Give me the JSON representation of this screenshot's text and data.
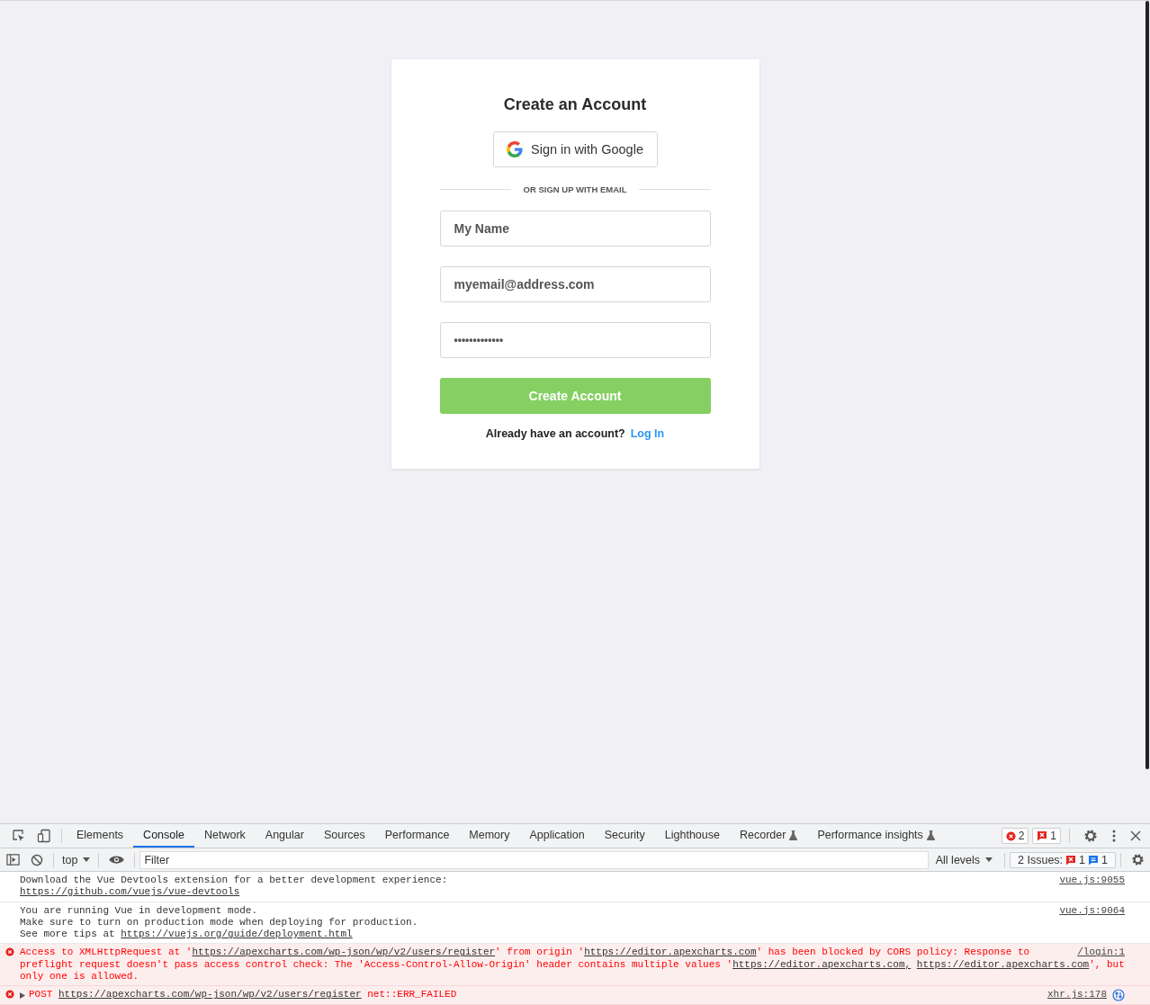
{
  "form": {
    "title": "Create an Account",
    "google_button": "Sign in with Google",
    "divider": "OR SIGN UP WITH EMAIL",
    "fields": [
      {
        "kind": "name",
        "value": "My Name"
      },
      {
        "kind": "email",
        "value": "myemail@address.com"
      },
      {
        "kind": "password",
        "value": "•••••••••••••"
      }
    ],
    "submit": "Create Account",
    "footer_text": "Already have an account?",
    "login_link": "Log In"
  },
  "devtools": {
    "tabs": [
      {
        "label": "Elements",
        "selected": false,
        "experimental": false
      },
      {
        "label": "Console",
        "selected": true,
        "experimental": false
      },
      {
        "label": "Network",
        "selected": false,
        "experimental": false
      },
      {
        "label": "Angular",
        "selected": false,
        "experimental": false
      },
      {
        "label": "Sources",
        "selected": false,
        "experimental": false
      },
      {
        "label": "Performance",
        "selected": false,
        "experimental": false
      },
      {
        "label": "Memory",
        "selected": false,
        "experimental": false
      },
      {
        "label": "Application",
        "selected": false,
        "experimental": false
      },
      {
        "label": "Security",
        "selected": false,
        "experimental": false
      },
      {
        "label": "Lighthouse",
        "selected": false,
        "experimental": false
      },
      {
        "label": "Recorder",
        "selected": false,
        "experimental": true
      },
      {
        "label": "Performance insights",
        "selected": false,
        "experimental": true
      }
    ],
    "error_count": "2",
    "issue_count": "1",
    "context": "top",
    "filter_placeholder": "Filter",
    "levels": "All levels",
    "issues_label": "2 Issues:",
    "issues_errors": "1",
    "issues_info": "1",
    "messages": [
      {
        "kind": "info",
        "source": "vue.js:9055",
        "lines": [
          [
            {
              "kind": "text",
              "text": "Download the Vue Devtools extension for a better development experience:"
            }
          ],
          [
            {
              "kind": "link",
              "text": "https://github.com/vuejs/vue-devtools"
            }
          ]
        ]
      },
      {
        "kind": "info",
        "source": "vue.js:9064",
        "lines": [
          [
            {
              "kind": "text",
              "text": "You are running Vue in development mode."
            }
          ],
          [
            {
              "kind": "text",
              "text": "Make sure to turn on production mode when deploying for production."
            }
          ],
          [
            {
              "kind": "text",
              "text": "See more tips at "
            },
            {
              "kind": "link",
              "text": "https://vuejs.org/guide/deployment.html"
            }
          ]
        ]
      },
      {
        "kind": "error",
        "source": "/login:1",
        "lines": [
          [
            {
              "kind": "text",
              "text": "Access to XMLHttpRequest at '"
            },
            {
              "kind": "link",
              "text": "https://apexcharts.com/wp-json/wp/v2/users/register"
            },
            {
              "kind": "text",
              "text": "' from origin '"
            },
            {
              "kind": "link",
              "text": "https://editor.apexcharts.com"
            },
            {
              "kind": "text",
              "text": "' has been blocked by CORS policy: Response to"
            }
          ],
          [
            {
              "kind": "text",
              "text": "preflight request doesn't pass access control check: The 'Access-Control-Allow-Origin' header contains multiple values '"
            },
            {
              "kind": "link",
              "text": "https://editor.apexcharts.com,"
            },
            {
              "kind": "link",
              "text": "https://editor.apexcharts.com"
            },
            {
              "kind": "text",
              "text": "', but"
            }
          ],
          [
            {
              "kind": "text",
              "text": "only one is allowed."
            }
          ]
        ]
      },
      {
        "kind": "error",
        "expanded": false,
        "network": true,
        "source": "xhr.js:178",
        "lines": [
          [
            {
              "kind": "text",
              "text": "POST "
            },
            {
              "kind": "link",
              "text": "https://apexcharts.com/wp-json/wp/v2/users/register"
            },
            {
              "kind": "text",
              "text": " net::ERR_FAILED"
            }
          ]
        ]
      }
    ]
  }
}
